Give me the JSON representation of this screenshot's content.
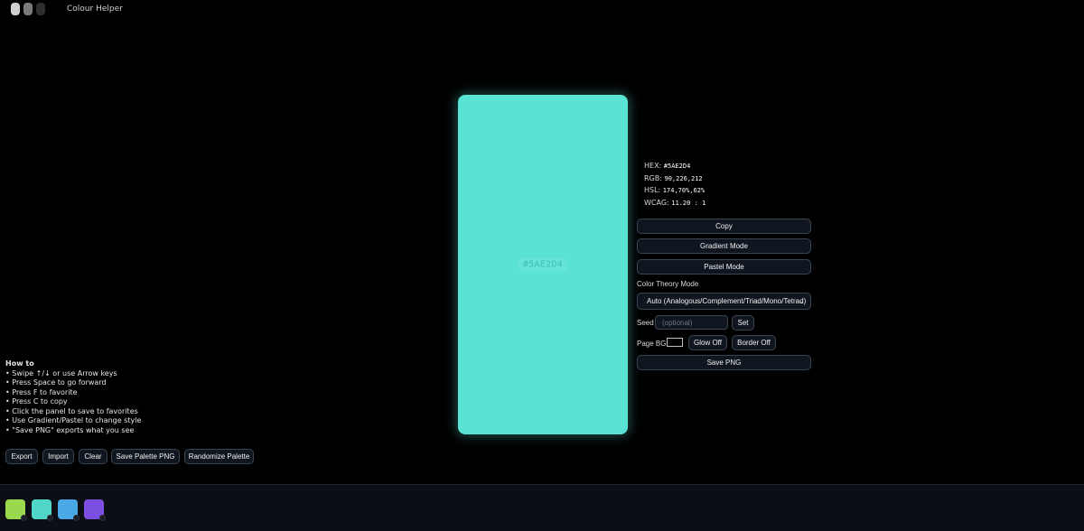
{
  "app": {
    "title": "Colour Helper"
  },
  "panel": {
    "hex": "#5AE2D4",
    "color": "#5AE2D4"
  },
  "info": {
    "hex_label": "HEX:",
    "hex_value": "#5AE2D4",
    "rgb_label": "RGB:",
    "rgb_value": "90,226,212",
    "hsl_label": "HSL:",
    "hsl_value": "174,70%,62%",
    "wcag_label": "WCAG:",
    "wcag_value": "11.20 : 1"
  },
  "controls": {
    "copy": "Copy",
    "gradient_mode": "Gradient Mode",
    "pastel_mode": "Pastel Mode",
    "theory_label": "Color Theory Mode",
    "theory_selected": "Auto (Analogous/Complement/Triad/Mono/Tetrad)",
    "seed_label": "Seed",
    "seed_placeholder": "(optional)",
    "set": "Set",
    "page_bg_label": "Page BG",
    "page_bg_color": "#000000",
    "glow": "Glow Off",
    "border": "Border Off",
    "save_png": "Save PNG"
  },
  "howto": {
    "title": "How to",
    "lines": [
      "• Swipe ↑/↓ or use Arrow keys",
      "• Press Space to go forward",
      "• Press F to favorite",
      "• Press C to copy",
      "• Click the panel to save to favorites",
      "• Use Gradient/Pastel to change style",
      "• \"Save PNG\" exports what you see"
    ]
  },
  "toolbar": {
    "export": "Export",
    "import": "Import",
    "clear": "Clear",
    "save_palette_png": "Save Palette PNG",
    "randomize_palette": "Randomize Palette"
  },
  "favorites": [
    "#9ad94e",
    "#4fd6c8",
    "#4aa8e6",
    "#7b4fe0"
  ]
}
